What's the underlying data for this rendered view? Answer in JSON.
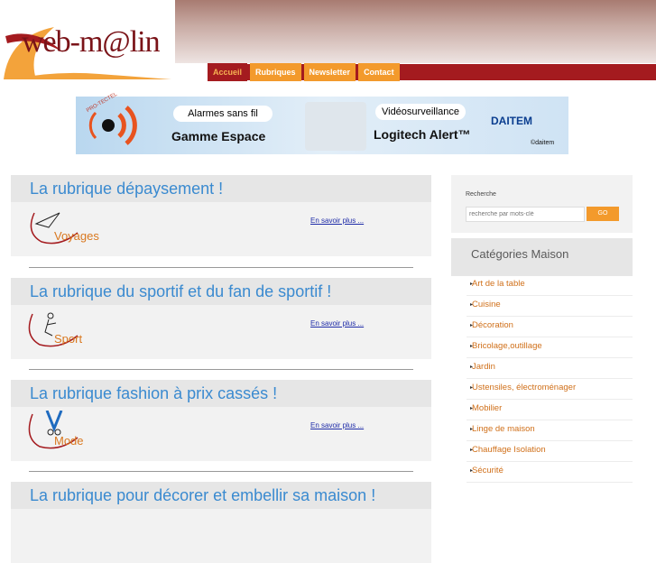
{
  "header": {
    "logo_text": "web-m@lin",
    "nav": [
      "Accueil",
      "Rubriques",
      "Newsletter",
      "Contact"
    ]
  },
  "banner": {
    "brand_ring": "PRO-TECTEL",
    "pill_left": "Alarmes sans fil",
    "strong_left": "Gamme Espace",
    "pill_right": "Vidéosurveillance",
    "strong_right": "Logitech Alert™",
    "daitem": "DAITEM",
    "credit": "©daitem"
  },
  "articles": [
    {
      "title": "La rubrique dépaysement !",
      "logo": "Voyages",
      "link": "En savoir plus ..."
    },
    {
      "title": "La rubrique du sportif et du fan de sportif !",
      "logo": "Sport",
      "link": "En savoir plus ..."
    },
    {
      "title": "La rubrique fashion à prix cassés !",
      "logo": "Mode",
      "link": "En savoir plus ..."
    },
    {
      "title": "La rubrique pour décorer et embellir sa maison !",
      "logo": "",
      "link": ""
    }
  ],
  "sidebar": {
    "search_label": "Recherche",
    "search_placeholder": "recherche par mots-clé",
    "go": "GO",
    "categories_title": "Catégories Maison",
    "categories": [
      "Art de la table",
      "Cuisine",
      "Décoration",
      "Bricolage,outillage",
      "Jardin",
      "Ustensiles, électroménager",
      "Mobilier",
      "Linge de maison",
      "Chauffage Isolation",
      "Sécurité"
    ]
  },
  "colors": {
    "accent": "#f39a2c",
    "brand_red": "#a41b1f",
    "title_blue": "#3a8ad0",
    "link_orange": "#d0701a"
  }
}
